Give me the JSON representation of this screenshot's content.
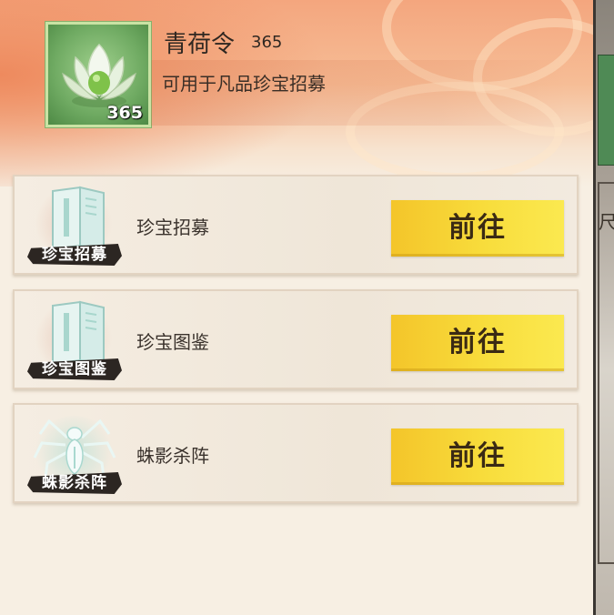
{
  "item": {
    "name": "青荷令",
    "quantity": "365",
    "icon_count": "365",
    "description": "可用于凡品珍宝招募",
    "icon": "lotus-icon"
  },
  "sources": [
    {
      "label": "珍宝招募",
      "badge": "珍宝招募",
      "button": "前往",
      "icon": "book-icon"
    },
    {
      "label": "珍宝图鉴",
      "badge": "珍宝图鉴",
      "button": "前往",
      "icon": "book-icon"
    },
    {
      "label": "蛛影杀阵",
      "badge": "蛛影杀阵",
      "button": "前往",
      "icon": "spider-icon"
    }
  ],
  "colors": {
    "button": "#f8dd3c",
    "header": "#f4a67e",
    "panel": "#f7efe3",
    "badge": "#2c2622"
  },
  "background_glyph": "尺"
}
